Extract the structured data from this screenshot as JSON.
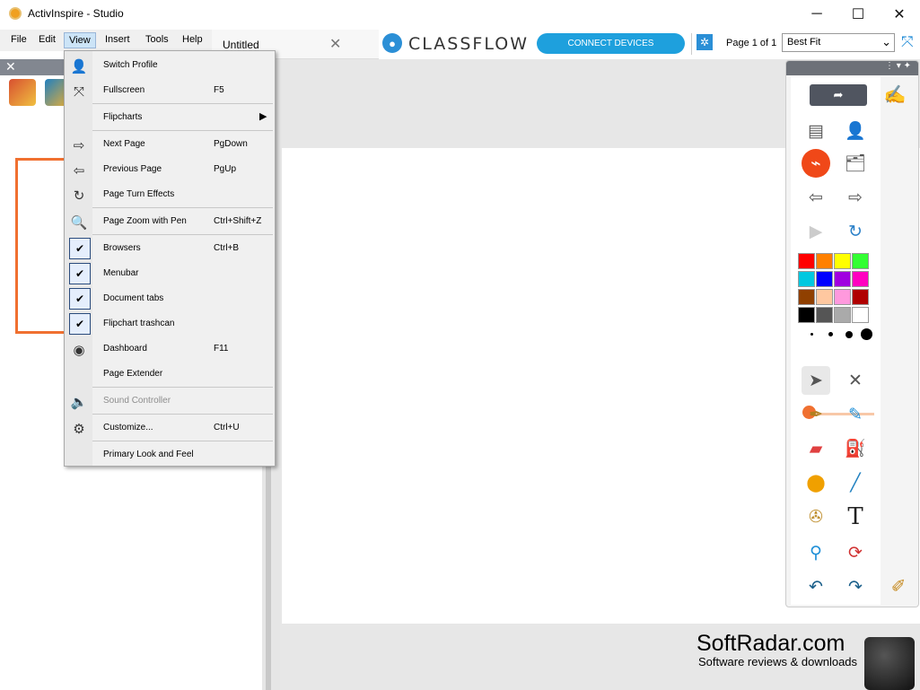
{
  "window": {
    "title": "ActivInspire - Studio",
    "minimize": "─",
    "maximize": "☐",
    "close": "✕"
  },
  "menubar": {
    "items": [
      "File",
      "Edit",
      "View",
      "Insert",
      "Tools",
      "Help"
    ]
  },
  "tabs": {
    "doc_title": "Untitled",
    "close": "✕"
  },
  "classflow": {
    "logo_text": "CLASSFLOW",
    "connect_label": "CONNECT DEVICES",
    "page_indicator": "Page 1 of 1",
    "zoom_value": "Best Fit"
  },
  "view_menu": {
    "items": [
      {
        "label": "Switch Profile",
        "shortcut": "",
        "icon": "profile-icon"
      },
      {
        "label": "Fullscreen",
        "shortcut": "F5",
        "icon": "fullscreen-icon"
      },
      {
        "label": "Flipcharts",
        "shortcut": "",
        "icon": "",
        "submenu": "▶"
      },
      {
        "label": "Next Page",
        "shortcut": "PgDown",
        "icon": "next-page-icon"
      },
      {
        "label": "Previous Page",
        "shortcut": "PgUp",
        "icon": "previous-page-icon"
      },
      {
        "label": "Page Turn Effects",
        "shortcut": "",
        "icon": "page-turn-icon"
      },
      {
        "label": "Page Zoom with Pen",
        "shortcut": "Ctrl+Shift+Z",
        "icon": "zoom-pen-icon"
      },
      {
        "label": "Browsers",
        "shortcut": "Ctrl+B",
        "checked": true
      },
      {
        "label": "Menubar",
        "shortcut": "",
        "checked": true
      },
      {
        "label": "Document tabs",
        "shortcut": "",
        "checked": true
      },
      {
        "label": "Flipchart trashcan",
        "shortcut": "",
        "checked": true
      },
      {
        "label": "Dashboard",
        "shortcut": "F11",
        "icon": "dashboard-icon"
      },
      {
        "label": "Page Extender",
        "shortcut": "",
        "icon": ""
      },
      {
        "label": "Sound Controller",
        "shortcut": "",
        "icon": "sound-icon",
        "disabled": true
      },
      {
        "label": "Customize...",
        "shortcut": "Ctrl+U",
        "icon": "customize-icon"
      },
      {
        "label": "Primary Look and Feel",
        "shortcut": "",
        "icon": ""
      }
    ]
  },
  "palette": {
    "colors": [
      "#ff0000",
      "#ff8000",
      "#ffff00",
      "#33ff33",
      "#00c8e0",
      "#0000ff",
      "#a000e0",
      "#ff00c0",
      "#904000",
      "#ffc8a0",
      "#ff99dd",
      "#b00000",
      "#000000",
      "#555555",
      "#aaaaaa",
      "#ffffff"
    ],
    "accent": "#f07030"
  },
  "watermark": {
    "title": "SoftRadar.com",
    "subtitle": "Software reviews & downloads"
  }
}
